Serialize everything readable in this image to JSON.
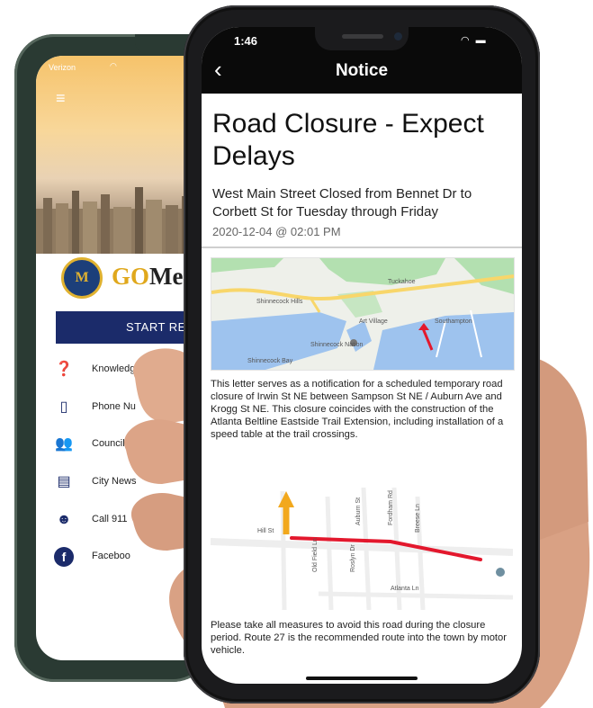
{
  "back_phone": {
    "carrier": "Verizon",
    "logo_text_a": "GO",
    "logo_text_b": "Me",
    "seal_letter": "M",
    "start_button": "START RE",
    "menu_items": [
      {
        "label": "Knowledge",
        "icon": "question-chat-icon"
      },
      {
        "label": "Phone Nu",
        "icon": "phone-icon"
      },
      {
        "label": "Council Memb",
        "icon": "people-icon"
      },
      {
        "label": "City News",
        "icon": "newspaper-icon"
      },
      {
        "label": "Call 911",
        "icon": "police-icon"
      },
      {
        "label": "Faceboo",
        "icon": "facebook-icon"
      }
    ]
  },
  "front_phone": {
    "time": "1:46",
    "header_title": "Notice",
    "back_icon": "chevron-left-icon",
    "notice": {
      "title": "Road Closure - Expect Delays",
      "subtitle": "West Main Street Closed from Bennet Dr to Corbett St for Tuesday through Friday",
      "date": "2020-12-04 @ 02:01 PM",
      "paragraph1": "This letter serves as a notification for a scheduled temporary road closure of Irwin St NE between Sampson St NE / Auburn Ave and Krogg St NE. This closure coincides with the construction of the Atlanta Beltline Eastside Trail Extension, including installation of a speed table at the trail crossings.",
      "paragraph2": "Please take all measures to avoid this road during the closure period.  Route 27 is the recommended route into the town by motor vehicle."
    },
    "map1_labels": {
      "tuckahoe": "Tuckahoe",
      "shinnecock_hills": "Shinnecock Hills",
      "art_village": "Art Village",
      "southampton": "Southampton",
      "shinnecock_nation": "Shinnecock Nation",
      "shinnecock_bay": "Shinnecock Bay"
    },
    "map2_labels": {
      "hill_st": "Hill St",
      "old_field_ln": "Old Field Ln",
      "roslyn_dr": "Roslyn Dr",
      "auburn_st": "Auburn St",
      "fordham_rd": "Fordham Rd",
      "breese_ln": "Breese Ln",
      "atlanta_ln": "Atlanta Ln"
    },
    "colors": {
      "closure_red": "#e3182d",
      "arrow_orange": "#f2a81d",
      "map_water": "#9ec3ee",
      "map_green": "#b3e0b0",
      "road_yellow": "#f8d66a"
    }
  }
}
